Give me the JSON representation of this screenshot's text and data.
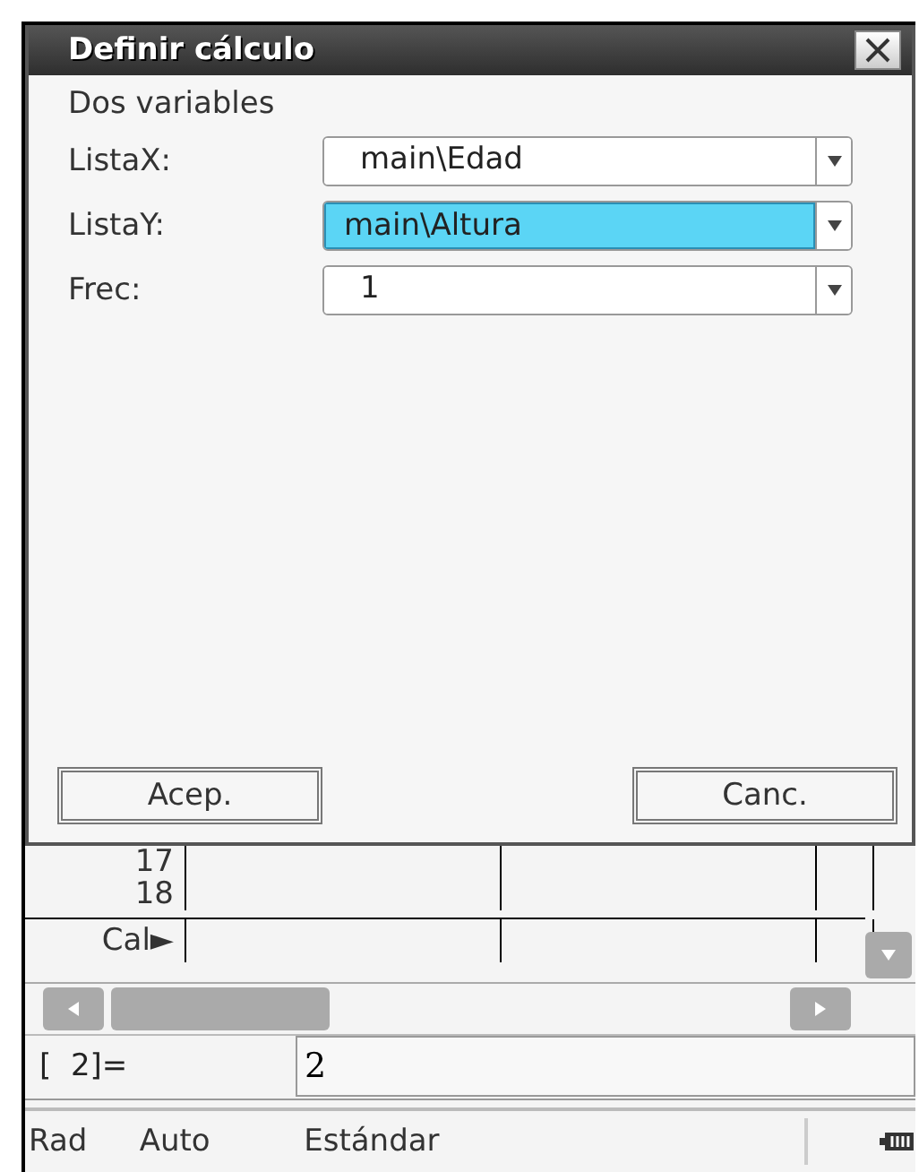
{
  "dialog": {
    "title": "Definir cálculo",
    "subtitle": "Dos variables",
    "fields": [
      {
        "label": "ListaX:",
        "value": "main\\Edad",
        "selected": false
      },
      {
        "label": "ListaY:",
        "value": "main\\Altura",
        "selected": true
      },
      {
        "label": "Frec:",
        "value": "1",
        "selected": false
      }
    ],
    "buttons": [
      "Acep.",
      "Canc."
    ]
  },
  "sheet": {
    "row_labels": [
      "17",
      "18"
    ],
    "calc_label": "Cal►"
  },
  "entry": {
    "label": "[  2]=",
    "value": "2"
  },
  "status_bar": [
    "Rad",
    "Auto",
    "Estándar"
  ]
}
